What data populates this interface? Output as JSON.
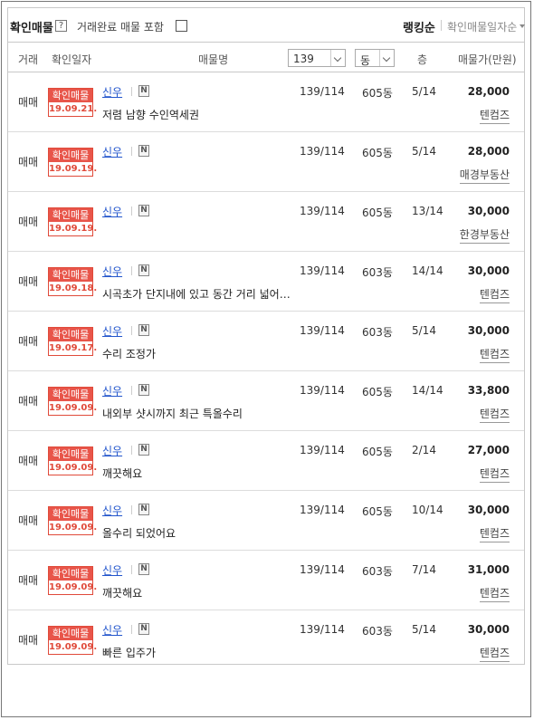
{
  "topbar": {
    "title": "확인매물",
    "help": "?",
    "include_label": "거래완료 매물 포함",
    "rank_label": "랭킹순",
    "sort_label": "확인매물일자순"
  },
  "header": {
    "col_type": "거래",
    "col_date": "확인일자",
    "col_name": "매물명",
    "area_select": "139",
    "dong_select": "동",
    "col_floor": "층",
    "col_price": "매물가(만원)"
  },
  "rows": [
    {
      "type": "매매",
      "badge_top": "확인매물",
      "badge_date": "19.09.21.",
      "name": "신우",
      "desc": "저렴 남향 수인역세권",
      "area": "139/114",
      "dong": "605동",
      "floor": "5/14",
      "price": "28,000",
      "agent": "텐컴즈"
    },
    {
      "type": "매매",
      "badge_top": "확인매물",
      "badge_date": "19.09.19.",
      "name": "신우",
      "desc": "",
      "area": "139/114",
      "dong": "605동",
      "floor": "5/14",
      "price": "28,000",
      "agent": "매경부동산"
    },
    {
      "type": "매매",
      "badge_top": "확인매물",
      "badge_date": "19.09.19.",
      "name": "신우",
      "desc": "",
      "area": "139/114",
      "dong": "605동",
      "floor": "13/14",
      "price": "30,000",
      "agent": "한경부동산"
    },
    {
      "type": "매매",
      "badge_top": "확인매물",
      "badge_date": "19.09.18.",
      "name": "신우",
      "desc": "시곡초가 단지내에 있고 동간 거리 넓어…",
      "area": "139/114",
      "dong": "603동",
      "floor": "14/14",
      "price": "30,000",
      "agent": "텐컴즈"
    },
    {
      "type": "매매",
      "badge_top": "확인매물",
      "badge_date": "19.09.17.",
      "name": "신우",
      "desc": "수리 조정가",
      "area": "139/114",
      "dong": "603동",
      "floor": "5/14",
      "price": "30,000",
      "agent": "텐컴즈"
    },
    {
      "type": "매매",
      "badge_top": "확인매물",
      "badge_date": "19.09.09.",
      "name": "신우",
      "desc": "내외부 샷시까지 최근 특올수리",
      "area": "139/114",
      "dong": "605동",
      "floor": "14/14",
      "price": "33,800",
      "agent": "텐컴즈"
    },
    {
      "type": "매매",
      "badge_top": "확인매물",
      "badge_date": "19.09.09.",
      "name": "신우",
      "desc": "깨끗해요",
      "area": "139/114",
      "dong": "605동",
      "floor": "2/14",
      "price": "27,000",
      "agent": "텐컴즈"
    },
    {
      "type": "매매",
      "badge_top": "확인매물",
      "badge_date": "19.09.09.",
      "name": "신우",
      "desc": "올수리 되었어요",
      "area": "139/114",
      "dong": "605동",
      "floor": "10/14",
      "price": "30,000",
      "agent": "텐컴즈"
    },
    {
      "type": "매매",
      "badge_top": "확인매물",
      "badge_date": "19.09.09.",
      "name": "신우",
      "desc": "깨끗해요",
      "area": "139/114",
      "dong": "603동",
      "floor": "7/14",
      "price": "31,000",
      "agent": "텐컴즈"
    },
    {
      "type": "매매",
      "badge_top": "확인매물",
      "badge_date": "19.09.09.",
      "name": "신우",
      "desc": "빠른 입주가",
      "area": "139/114",
      "dong": "603동",
      "floor": "5/14",
      "price": "30,000",
      "agent": "텐컴즈"
    }
  ],
  "icons": {
    "naver": "N"
  }
}
